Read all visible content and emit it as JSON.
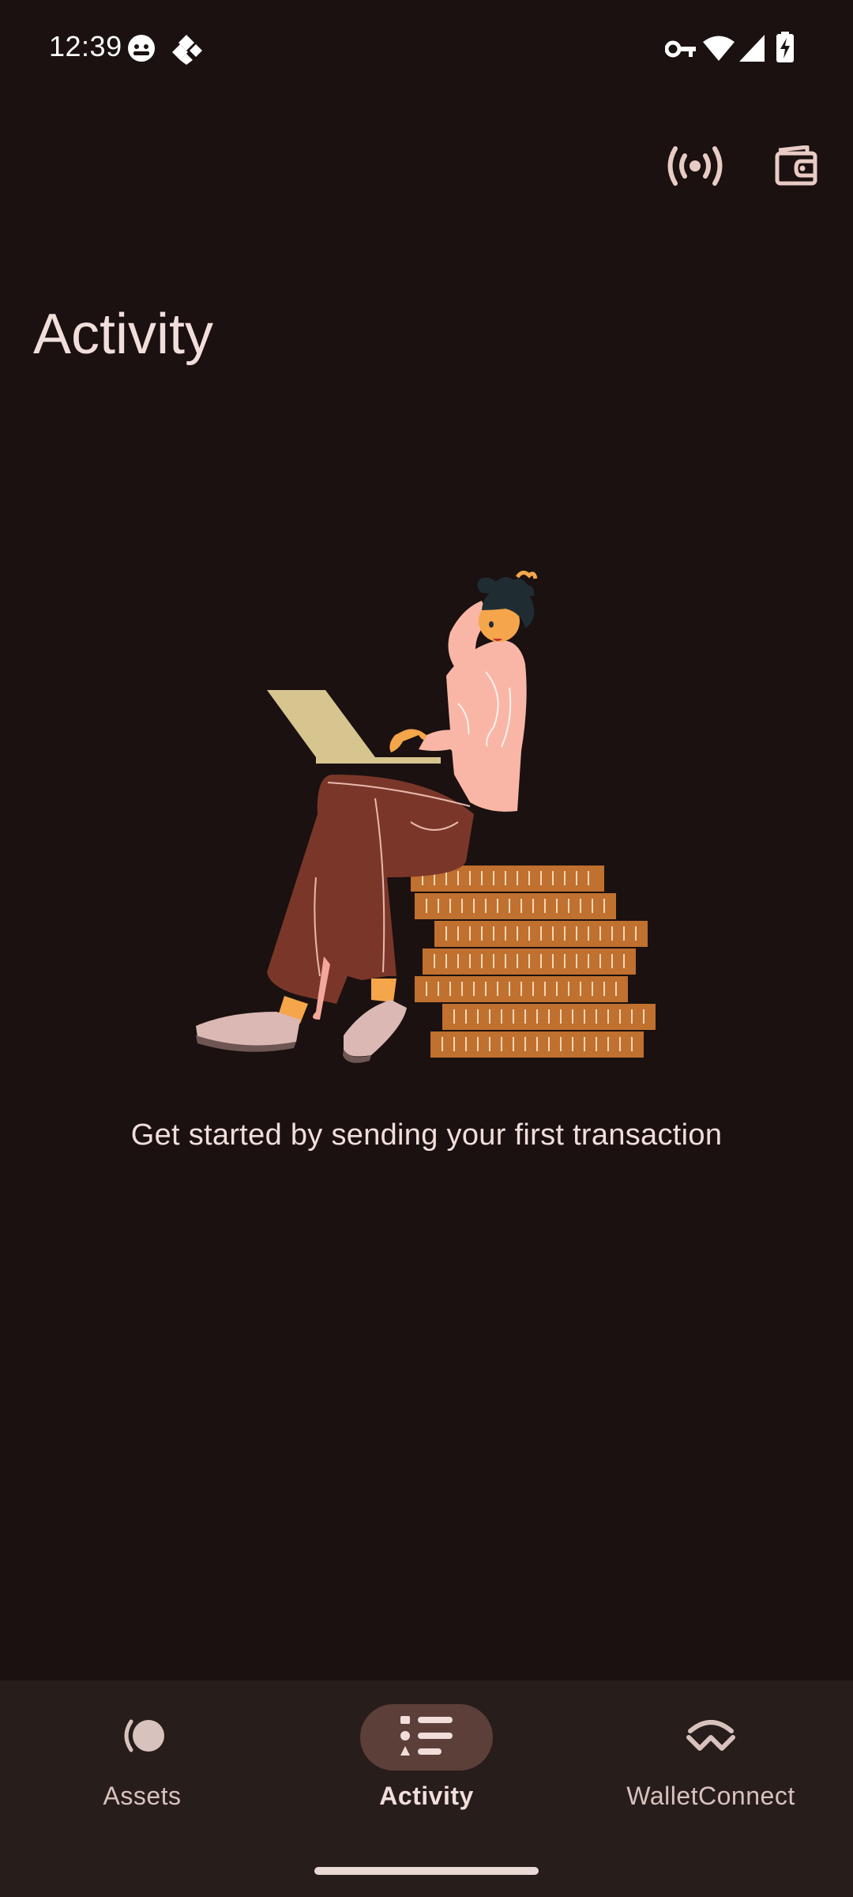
{
  "status_bar": {
    "time": "12:39",
    "icons": [
      "face-notification-icon",
      "app-notification-icon",
      "vpn-key-icon",
      "wifi-icon",
      "cellular-signal-icon",
      "battery-charging-icon"
    ]
  },
  "header": {
    "actions": [
      "broadcast-icon",
      "wallet-icon"
    ],
    "title": "Activity"
  },
  "empty_state": {
    "illustration": "person-on-coins-with-laptop",
    "message": "Get started by sending your first transaction"
  },
  "bottom_nav": {
    "items": [
      {
        "label": "Assets",
        "icon": "assets-icon",
        "active": false
      },
      {
        "label": "Activity",
        "icon": "list-icon",
        "active": true
      },
      {
        "label": "WalletConnect",
        "icon": "walletconnect-icon",
        "active": false
      }
    ]
  },
  "colors": {
    "background": "#1a1110",
    "nav_background": "#271d1b",
    "active_pill": "#5c3f39",
    "text": "#f1dedb"
  }
}
